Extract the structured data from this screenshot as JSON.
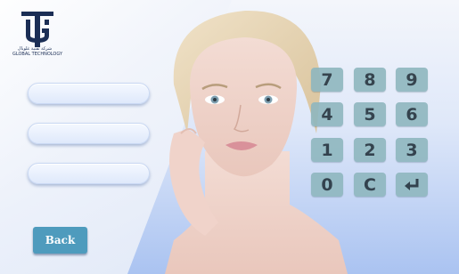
{
  "logo": {
    "caption_line1": "شركة تقنية غلوبال",
    "caption_line2": "GLOBAL TECHNOLOGY"
  },
  "form": {
    "fields": [
      {
        "value": ""
      },
      {
        "value": ""
      },
      {
        "value": ""
      }
    ]
  },
  "keypad": {
    "keys": [
      "7",
      "8",
      "9",
      "4",
      "5",
      "6",
      "1",
      "2",
      "3",
      "0",
      "C"
    ],
    "enter_icon": "enter-return-icon"
  },
  "back_button": {
    "label": "Back"
  },
  "colors": {
    "key_bg": "#8fb7bf",
    "back_bg": "#4e9bbd",
    "logo": "#1b2e55"
  }
}
